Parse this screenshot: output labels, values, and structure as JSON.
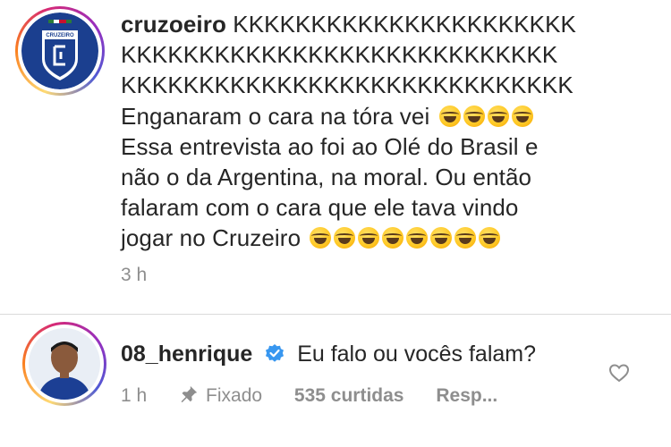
{
  "comments": [
    {
      "username": "cruzoeiro",
      "lines": [
        "KKKKKKKKKKKKKKKKKKKKKK",
        "KKKKKKKKKKKKKKKKKKKKKKKKKKKK",
        "KKKKKKKKKKKKKKKKKKKKKKKKKKKKK",
        "Enganaram o cara na tóra vei",
        "Essa entrevista ao foi ao Olé do Brasil e",
        "não o da Argentina, na moral. Ou então",
        "falaram com o cara que ele tava vindo",
        "jogar no Cruzeiro"
      ],
      "emoji_line4_count": 4,
      "emoji_line8_count": 8,
      "emoji_name": "rolling-on-floor-laughing-emoji",
      "time": "3 h",
      "avatar_label": "CRUZEIRO"
    },
    {
      "username": "08_henrique",
      "verified": true,
      "text": "Eu falo ou vocês falam?",
      "time": "1 h",
      "pinned_label": "Fixado",
      "likes": "535 curtidas",
      "reply_label": "Resp..."
    }
  ],
  "colors": {
    "text": "#262626",
    "meta": "#8e8e8e",
    "verified": "#3897f0",
    "separator": "#dbdbdb"
  }
}
